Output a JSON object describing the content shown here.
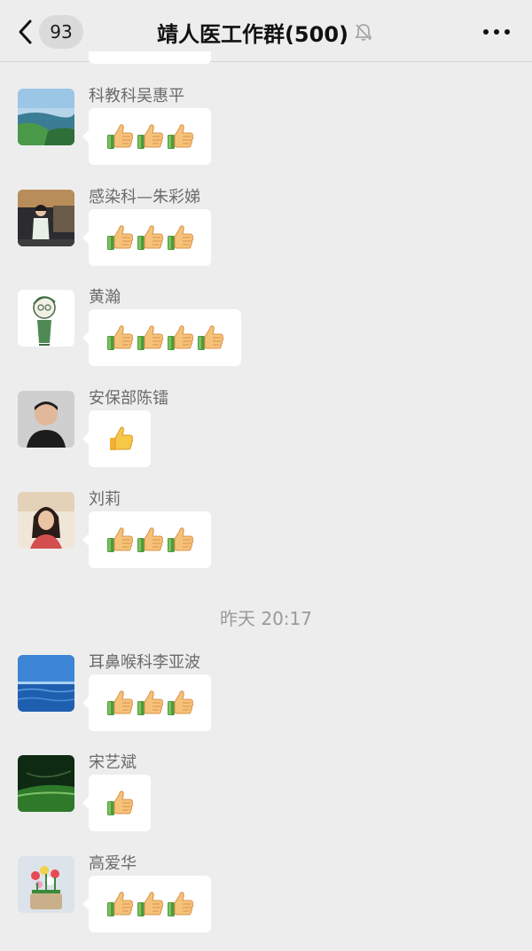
{
  "header": {
    "back_icon": "chevron-left-icon",
    "unread_count": "93",
    "title": "靖人医工作群(500)",
    "mute_icon": "bell-muted-icon",
    "more_icon": "more-dots-icon"
  },
  "messages": [
    {
      "sender": "科教科吴惠平",
      "avatar": "lake-landscape",
      "thumbs": 3
    },
    {
      "sender": "感染科—朱彩娣",
      "avatar": "woman-in-dress",
      "thumbs": 3
    },
    {
      "sender": "黄瀚",
      "avatar": "cartoon-man-green",
      "thumbs": 4
    },
    {
      "sender": "安保部陈镭",
      "avatar": "man-portrait",
      "thumbs": 1
    },
    {
      "sender": "刘莉",
      "avatar": "woman-portrait",
      "thumbs": 3
    }
  ],
  "timestamp": "昨天 20:17",
  "messages_after": [
    {
      "sender": "耳鼻喉科李亚波",
      "avatar": "ocean-sky",
      "thumbs": 3
    },
    {
      "sender": "宋艺斌",
      "avatar": "green-field",
      "thumbs": 1
    },
    {
      "sender": "高爱华",
      "avatar": "flower-basket",
      "thumbs": 3
    }
  ],
  "colors": {
    "background": "#ededed",
    "bubble": "#ffffff",
    "sender_text": "#6b6b6b",
    "timestamp_text": "#9a9a9a"
  },
  "emoji": "thumbs-up-emoji"
}
